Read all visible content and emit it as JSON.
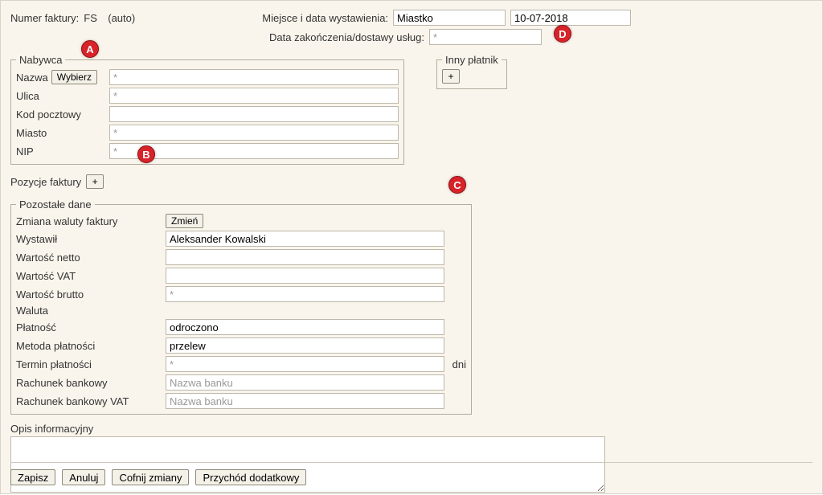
{
  "header": {
    "numer_faktury_label": "Numer faktury:",
    "numer_faktury_prefix": "FS",
    "numer_faktury_auto": "(auto)",
    "miejsce_data_label": "Miejsce i data wystawienia:",
    "miejsce_value": "Miastko",
    "data_value": "10-07-2018",
    "data_zakonczenia_label": "Data zakończenia/dostawy usług:",
    "data_zakonczenia_value": "",
    "data_zakonczenia_placeholder": "*"
  },
  "nabywca": {
    "legend": "Nabywca",
    "nazwa_label": "Nazwa",
    "wybierz_btn": "Wybierz",
    "nazwa_value": "",
    "nazwa_placeholder": "*",
    "ulica_label": "Ulica",
    "ulica_value": "",
    "ulica_placeholder": "*",
    "kod_label": "Kod pocztowy",
    "kod_value": "",
    "miasto_label": "Miasto",
    "miasto_value": "",
    "miasto_placeholder": "*",
    "nip_label": "NIP",
    "nip_value": "",
    "nip_placeholder": "*"
  },
  "inny_platnik": {
    "legend": "Inny płatnik",
    "add_btn": "+"
  },
  "pozycje": {
    "label": "Pozycje faktury",
    "add_btn": "+"
  },
  "pozostale": {
    "legend": "Pozostałe dane",
    "zmiana_waluty_label": "Zmiana waluty faktury",
    "zmien_btn": "Zmień",
    "wystawil_label": "Wystawił",
    "wystawil_value": "Aleksander Kowalski",
    "netto_label": "Wartość netto",
    "netto_value": "",
    "vat_label": "Wartość VAT",
    "vat_value": "",
    "brutto_label": "Wartość brutto",
    "brutto_value": "",
    "brutto_placeholder": "*",
    "waluta_label": "Waluta",
    "waluta_value": "",
    "platnosc_label": "Płatność",
    "platnosc_value": "odroczono",
    "metoda_label": "Metoda płatności",
    "metoda_value": "przelew",
    "termin_label": "Termin płatności",
    "termin_value": "",
    "termin_placeholder": "*",
    "termin_suffix": "dni",
    "rachunek_label": "Rachunek bankowy",
    "rachunek_value": "",
    "rachunek_placeholder": "Nazwa banku",
    "rachunek_vat_label": "Rachunek bankowy VAT",
    "rachunek_vat_value": "",
    "rachunek_vat_placeholder": "Nazwa banku"
  },
  "opis": {
    "label": "Opis informacyjny",
    "value": ""
  },
  "buttons": {
    "zapisz": "Zapisz",
    "anuluj": "Anuluj",
    "cofnij": "Cofnij zmiany",
    "przychod": "Przychód dodatkowy"
  },
  "markers": {
    "a": "A",
    "b": "B",
    "c": "C",
    "d": "D"
  }
}
